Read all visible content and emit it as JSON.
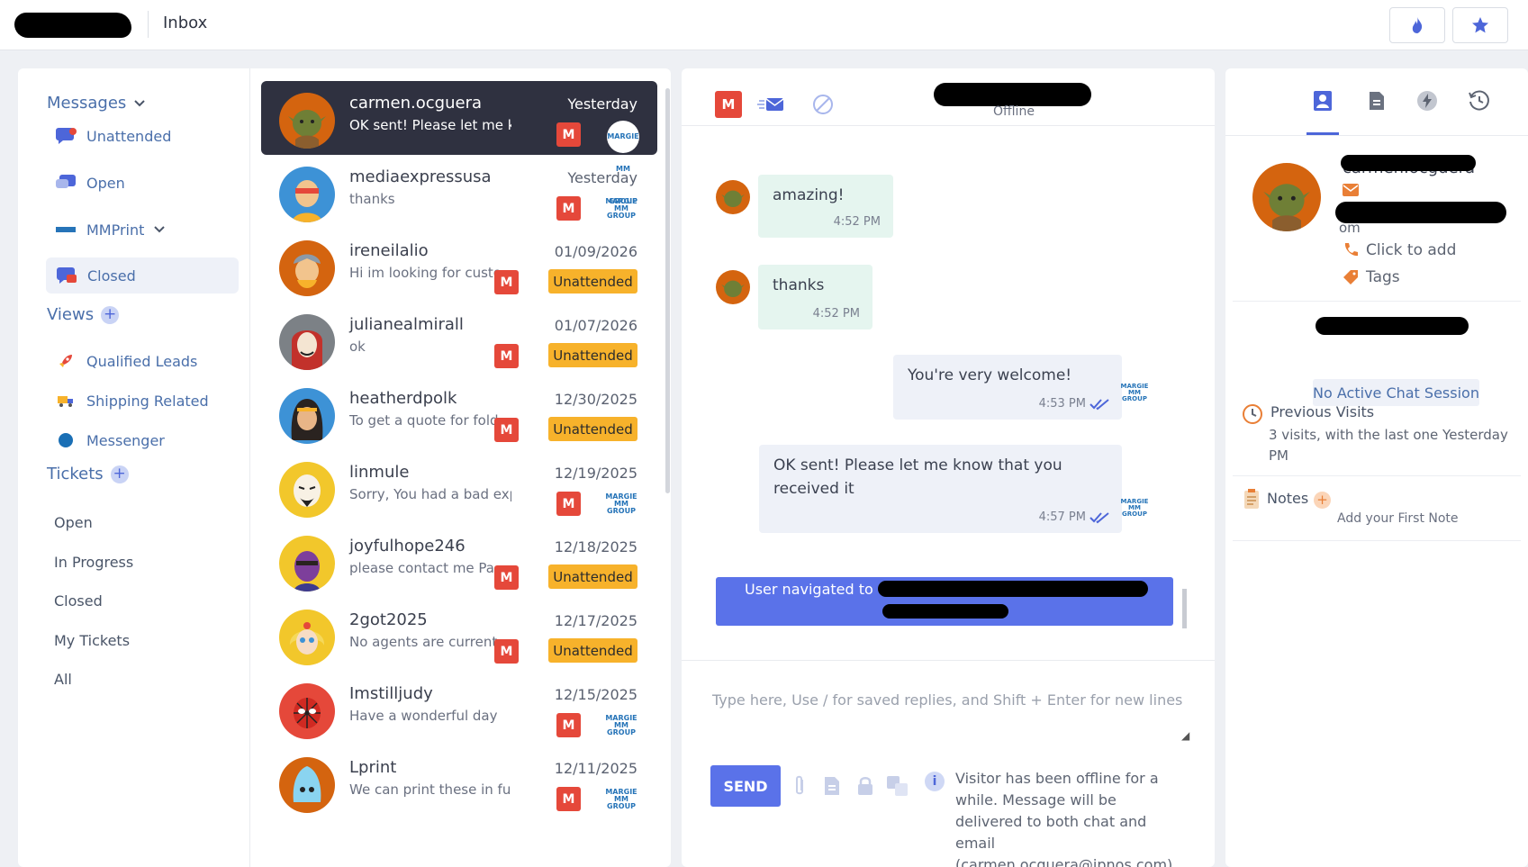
{
  "header": {
    "title": "Inbox"
  },
  "nav": {
    "messages_label": "Messages",
    "messages_items": [
      {
        "label": "Unattended"
      },
      {
        "label": "Open"
      },
      {
        "label": "MMPrint"
      },
      {
        "label": "Closed"
      }
    ],
    "views_label": "Views",
    "views_items": [
      {
        "label": "Qualified Leads"
      },
      {
        "label": "Shipping Related"
      },
      {
        "label": "Messenger"
      }
    ],
    "tickets_label": "Tickets",
    "tickets_items": [
      {
        "label": "Open"
      },
      {
        "label": "In Progress"
      },
      {
        "label": "Closed"
      },
      {
        "label": "My Tickets"
      },
      {
        "label": "All"
      }
    ]
  },
  "conversations": [
    {
      "name": "carmen.ocguera",
      "time": "Yesterday",
      "preview": "OK sent! Please let me know t",
      "badge": "M",
      "status": "",
      "selected": true
    },
    {
      "name": "mediaexpressusa",
      "time": "Yesterday",
      "preview": "thanks",
      "badge": "M",
      "status": ""
    },
    {
      "name": "ireneilalio",
      "time": "01/09/2026",
      "preview": "Hi im looking for custo",
      "badge": "M",
      "status": "Unattended"
    },
    {
      "name": "julianealmirall",
      "time": "01/07/2026",
      "preview": "ok",
      "badge": "M",
      "status": "Unattended"
    },
    {
      "name": "heatherdpolk",
      "time": "12/30/2025",
      "preview": "To get a quote for fold",
      "badge": "M",
      "status": "Unattended"
    },
    {
      "name": "linmule",
      "time": "12/19/2025",
      "preview": "Sorry, You had a bad experie",
      "badge": "M",
      "status": ""
    },
    {
      "name": "joyfulhope246",
      "time": "12/18/2025",
      "preview": "please contact me Pa",
      "badge": "M",
      "status": "Unattended"
    },
    {
      "name": "2got2025",
      "time": "12/17/2025",
      "preview": "No agents are current",
      "badge": "M",
      "status": "Unattended"
    },
    {
      "name": "Imstilljudy",
      "time": "12/15/2025",
      "preview": "Have a wonderful day",
      "badge": "M",
      "status": ""
    },
    {
      "name": "Lprint",
      "time": "12/11/2025",
      "preview": "We can print these in full colo",
      "badge": "M",
      "status": ""
    }
  ],
  "mini_logo_text": "MARGIE MM GROUP",
  "chat": {
    "badge": "M",
    "status": "Offline",
    "messages": [
      {
        "text": "amazing!",
        "time": "4:52 PM",
        "direction": "in"
      },
      {
        "text": "thanks",
        "time": "4:52 PM",
        "direction": "in"
      },
      {
        "text": "You're very welcome!",
        "time": "4:53 PM",
        "direction": "out"
      },
      {
        "text": "OK sent! Please let me know that you received it",
        "time": "4:57 PM",
        "direction": "out"
      }
    ],
    "event": "User navigated to",
    "composer_placeholder": "Type here, Use / for saved replies, and Shift + Enter for new lines",
    "send_label": "SEND",
    "info_text": "Visitor has been offline for a while. Message will be delivered to both chat and email (carmen.ocguera@ipnos.com)."
  },
  "profile": {
    "name": "carmen.ocguera",
    "email_tail": "om",
    "phone_placeholder": "Click to add",
    "tags_label": "Tags",
    "no_session": "No Active Chat Session",
    "visits_title": "Previous Visits",
    "visits_text": "3 visits, with the last one Yesterday PM",
    "notes_title": "Notes",
    "notes_placeholder": "Add your First Note"
  },
  "colors": {
    "accent": "#5a72e9",
    "badge_red": "#e5483a",
    "unattended": "#f7b22b",
    "selected_row": "#2f3140"
  }
}
